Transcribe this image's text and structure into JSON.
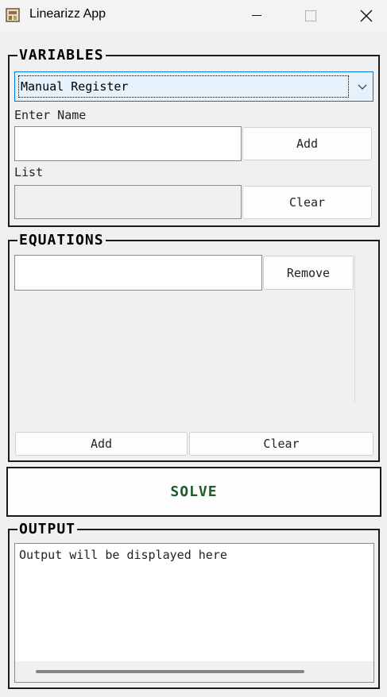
{
  "window": {
    "title": "Linearizz App"
  },
  "variables": {
    "title": "VARIABLES",
    "mode_selected": "Manual Register",
    "enter_name_label": "Enter Name",
    "name_value": "",
    "add_label": "Add",
    "list_label": "List",
    "list_value": "",
    "clear_label": "Clear"
  },
  "equations": {
    "title": "EQUATIONS",
    "equation_value": "",
    "remove_label": "Remove",
    "add_label": "Add",
    "clear_label": "Clear"
  },
  "solve": {
    "label": "SOLVE",
    "color": "#1e5c2b"
  },
  "output": {
    "title": "OUTPUT",
    "text": "Output will be displayed here"
  },
  "icons": [
    "app-icon",
    "minimize-icon",
    "maximize-icon",
    "close-icon",
    "chevron-down-icon"
  ]
}
